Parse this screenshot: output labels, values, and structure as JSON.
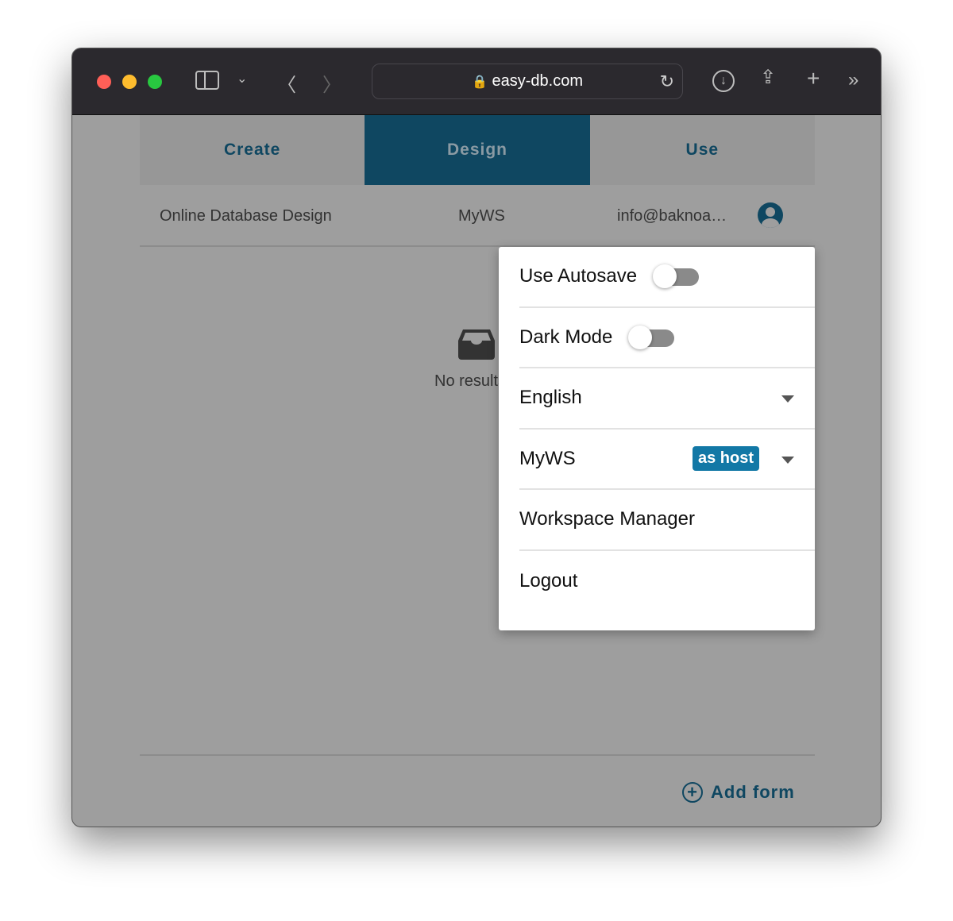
{
  "browser": {
    "url": "easy-db.com",
    "traffic_lights": {
      "close": "#ff5f57",
      "minimize": "#febc2e",
      "zoom": "#28c840"
    }
  },
  "tabs": [
    {
      "label": "Create"
    },
    {
      "label": "Design",
      "active": true
    },
    {
      "label": "Use"
    }
  ],
  "header": {
    "app_name": "Online Database Design",
    "workspace": "MyWS",
    "email": "info@baknoa…"
  },
  "empty": {
    "text": "No results"
  },
  "footer": {
    "add_form": "Add form"
  },
  "menu": {
    "autosave": {
      "label": "Use Autosave",
      "on": false
    },
    "dark_mode": {
      "label": "Dark Mode",
      "on": false
    },
    "language": {
      "value": "English"
    },
    "workspace": {
      "value": "MyWS",
      "badge": "as host"
    },
    "workspace_manager": "Workspace Manager",
    "logout": "Logout"
  },
  "colors": {
    "primary": "#0f4761",
    "badge": "#1278a6"
  }
}
